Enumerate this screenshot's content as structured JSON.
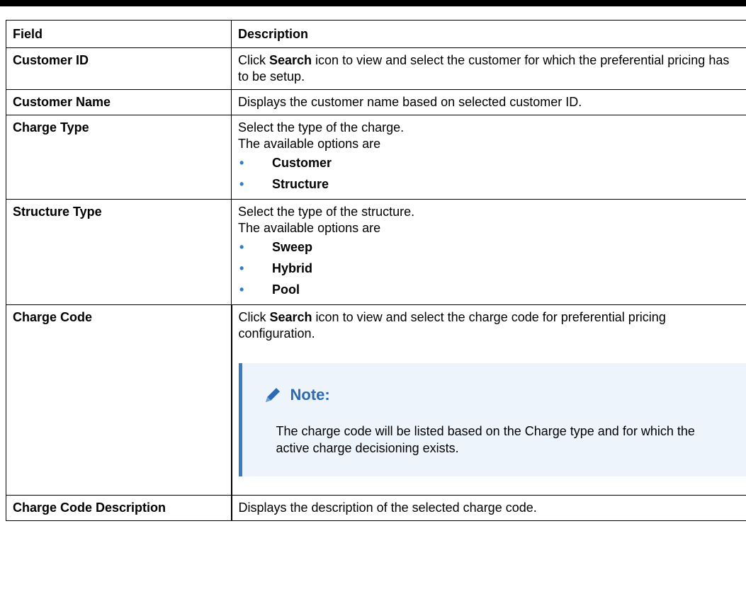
{
  "table": {
    "headers": {
      "field": "Field",
      "description": "Description"
    },
    "rows": {
      "customer_id": {
        "field": "Customer ID",
        "desc_pre": "Click ",
        "desc_bold": "Search",
        "desc_post": " icon to view and select the customer for which the preferential pricing has to be setup."
      },
      "customer_name": {
        "field": "Customer Name",
        "desc": "Displays the customer name based on selected customer ID."
      },
      "charge_type": {
        "field": "Charge Type",
        "line1": "Select the type of the charge.",
        "line2": "The available options are",
        "options": [
          "Customer",
          "Structure"
        ]
      },
      "structure_type": {
        "field": "Structure Type",
        "line1": "Select the type of the structure.",
        "line2": "The available options are",
        "options": [
          "Sweep",
          "Hybrid",
          "Pool"
        ]
      },
      "charge_code": {
        "field": "Charge Code",
        "desc_pre": "Click ",
        "desc_bold": "Search",
        "desc_post": " icon to view and select the charge code for preferential pricing configuration.",
        "note_title": "Note:",
        "note_text": "The charge code will be listed based on the Charge type and for which the active charge decisioning exists."
      },
      "charge_code_description": {
        "field": "Charge Code Description",
        "desc": "Displays the description of the selected charge code."
      }
    },
    "bullet_glyph": "•",
    "colors": {
      "note_accent": "#3a7cc3",
      "note_bg": "#eef4fb",
      "bullet": "#2f7ec8"
    },
    "note_icon": "pencil-icon"
  }
}
